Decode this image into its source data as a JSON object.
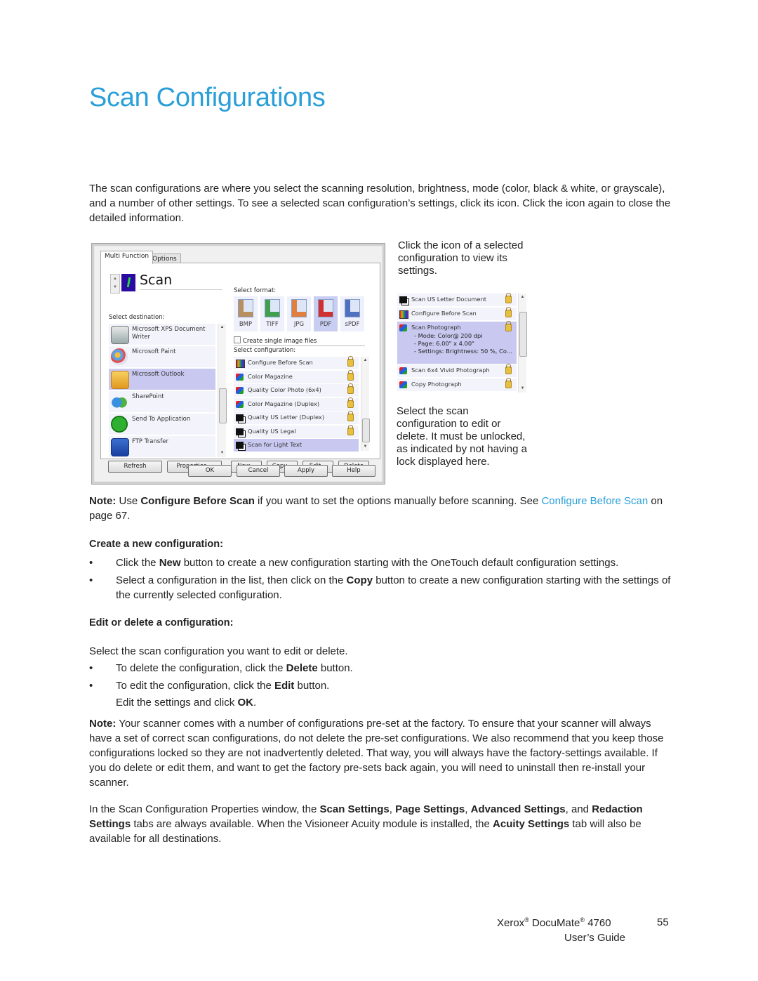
{
  "page": {
    "title": "Scan Configurations",
    "intro": "The scan configurations are where you select the scanning resolution, brightness, mode (color, black & white, or grayscale), and a number of other settings. To see a selected scan configuration’s settings, click its icon. Click the icon again to close the detailed information."
  },
  "dialog": {
    "tabs": [
      "Multi Function",
      "Options"
    ],
    "active_tab": "Multi Function",
    "button_name": "Scan",
    "select_destination_label": "Select destination:",
    "destinations": [
      {
        "name": "Microsoft XPS Document Writer",
        "icon": "printer-icon",
        "selected": false
      },
      {
        "name": "Microsoft Paint",
        "icon": "paint-palette-icon",
        "selected": false
      },
      {
        "name": "Microsoft Outlook",
        "icon": "outlook-envelope-icon",
        "selected": true
      },
      {
        "name": "SharePoint",
        "icon": "sharepoint-people-icon",
        "selected": false
      },
      {
        "name": "Send To Application",
        "icon": "send-to-application-icon",
        "selected": false
      },
      {
        "name": "FTP Transfer",
        "icon": "ftp-transfer-icon",
        "selected": false
      }
    ],
    "select_format_label": "Select format:",
    "formats": [
      {
        "label": "BMP",
        "selected": false
      },
      {
        "label": "TIFF",
        "selected": false
      },
      {
        "label": "JPG",
        "selected": false
      },
      {
        "label": "PDF",
        "selected": true
      },
      {
        "label": "sPDF",
        "selected": false
      }
    ],
    "single_image_checkbox": {
      "label": "Create single image files",
      "checked": false
    },
    "select_configuration_label": "Select configuration:",
    "configurations": [
      {
        "name": "Configure Before Scan",
        "icon": "configure-before-scan-icon",
        "locked": true,
        "selected": false
      },
      {
        "name": "Color Magazine",
        "icon": "color-config-icon",
        "locked": true,
        "selected": false
      },
      {
        "name": "Quality Color Photo (6x4)",
        "icon": "color-config-icon",
        "locked": true,
        "selected": false
      },
      {
        "name": "Color Magazine (Duplex)",
        "icon": "color-config-icon",
        "locked": true,
        "selected": false
      },
      {
        "name": "Quality US Letter (Duplex)",
        "icon": "bw-config-icon",
        "locked": true,
        "selected": false
      },
      {
        "name": "Quality US Legal",
        "icon": "bw-config-icon",
        "locked": true,
        "selected": false
      },
      {
        "name": "Scan for Light Text",
        "icon": "bw-config-icon",
        "locked": false,
        "selected": true
      }
    ],
    "buttons_row1": [
      "Refresh",
      "Properties...",
      "New...",
      "Copy...",
      "Edit...",
      "Delete"
    ],
    "buttons_row2": [
      "OK",
      "Cancel",
      "Apply",
      "Help"
    ]
  },
  "callouts": {
    "top": "Click the icon of a selected configuration to view its settings.",
    "bottom": "Select the scan configuration to edit or delete. It must be unlocked, as indicated by not having a lock displayed here."
  },
  "side_list": {
    "items": [
      {
        "name": "Scan US Letter Document",
        "icon": "bw-config-icon",
        "locked": true,
        "selected": false
      },
      {
        "name": "Configure Before Scan",
        "icon": "configure-before-scan-icon",
        "locked": true,
        "selected": false
      },
      {
        "name": "Scan Photograph",
        "icon": "color-config-icon",
        "locked": true,
        "selected": true,
        "details": [
          "- Mode: Color@ 200 dpi",
          "- Page:  6.00\" x  4.00\"",
          "- Settings: Brightness: 50 %, Co..."
        ]
      },
      {
        "name": "Scan 6x4 Vivid Photograph",
        "icon": "color-config-icon",
        "locked": true,
        "selected": false
      },
      {
        "name": "Copy Photograph",
        "icon": "color-config-icon",
        "locked": true,
        "selected": false
      }
    ]
  },
  "note1": {
    "label": "Note:",
    "pre": " Use ",
    "bold": "Configure Before Scan",
    "mid": " if you want to set the options manually before scanning. See ",
    "link": "Configure Before Scan",
    "post": " on page 67."
  },
  "create_section": {
    "heading": "Create a new configuration:",
    "bullets": [
      {
        "pre": "Click the ",
        "bold": "New",
        "post": " button to create a new configuration starting with the OneTouch default configuration settings."
      },
      {
        "pre": "Select a configuration in the list, then click on the ",
        "bold": "Copy",
        "post": " button to create a new configuration starting with the settings of the currently selected configuration."
      }
    ]
  },
  "edit_section": {
    "heading": "Edit or delete a configuration:",
    "intro": "Select the scan configuration you want to edit or delete.",
    "bullets": [
      {
        "pre": "To delete the configuration, click the ",
        "bold": "Delete",
        "post": " button."
      },
      {
        "pre": "To edit the configuration, click the ",
        "bold": "Edit",
        "post": " button."
      }
    ],
    "followup_pre": "Edit the settings and click ",
    "followup_bold": "OK",
    "followup_post": "."
  },
  "note2": {
    "label": "Note:",
    "text": " Your scanner comes with a number of configurations pre-set at the factory. To ensure that your scanner will always have a set of correct scan configurations, do not delete the pre-set configurations. We also recommend that you keep those configurations locked so they are not inadvertently deleted. That way, you will always have the factory-settings available. If you do delete or edit them, and want to get the factory pre-sets back again, you will need to uninstall then re-install your scanner."
  },
  "properties_para": {
    "t1": "In the Scan Configuration Properties window, the ",
    "b1": "Scan Settings",
    "t2": ", ",
    "b2": "Page Settings",
    "t3": ", ",
    "b3": "Advanced Settings",
    "t4": ", and ",
    "b4": "Redaction Settings",
    "t5": " tabs are always available. When the Visioneer Acuity module is installed, the ",
    "b5": "Acuity Settings",
    "t6": " tab will also be available for all destinations."
  },
  "footer": {
    "brand": "Xerox",
    "product": "DocuMate",
    "model": "4760",
    "registered": "®",
    "guide": "User’s Guide",
    "page_number": "55"
  },
  "colors": {
    "accent": "#2a9fd8",
    "selection": "#c8c8f0"
  }
}
